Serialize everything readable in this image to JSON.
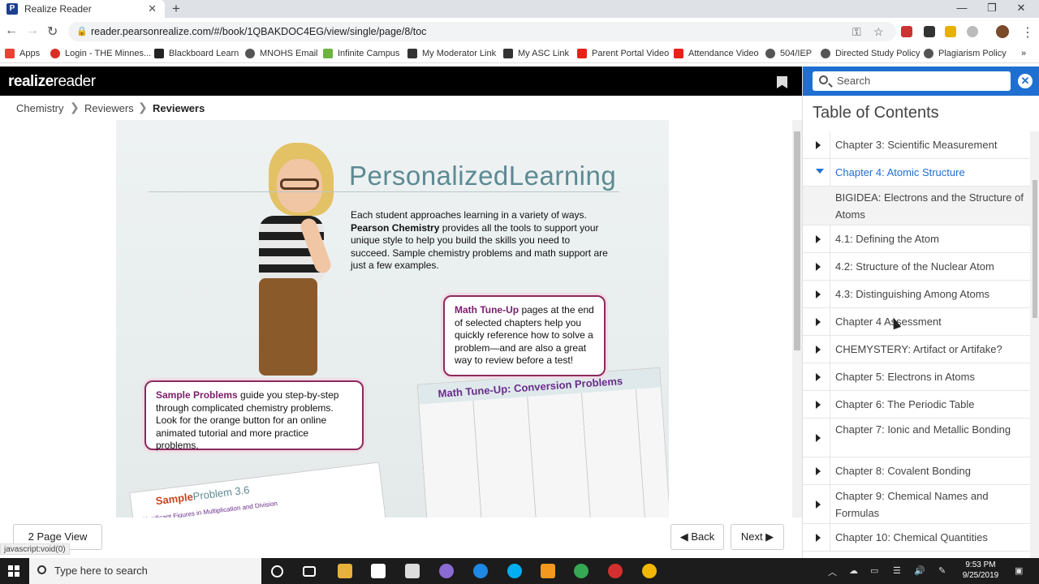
{
  "browser": {
    "tab_title": "Realize Reader",
    "tab_favicon": "P",
    "new_tab_symbol": "+",
    "url": "reader.pearsonrealize.com/#/book/1QBAKDOC4EG/view/single/page/8/toc",
    "bookmarks": [
      {
        "label": "Apps",
        "color": "#e94235"
      },
      {
        "label": "Login - THE Minnes...",
        "color": "#d93025"
      },
      {
        "label": "Blackboard Learn",
        "color": "#222222"
      },
      {
        "label": "MNOHS Email",
        "color": "#555555"
      },
      {
        "label": "Infinite Campus",
        "color": "#6cb33f"
      },
      {
        "label": "My Moderator Link",
        "color": "#333333"
      },
      {
        "label": "My ASC Link",
        "color": "#333333"
      },
      {
        "label": "Parent Portal Video",
        "color": "#e62117"
      },
      {
        "label": "Attendance Video",
        "color": "#e62117"
      },
      {
        "label": "504/IEP",
        "color": "#555555"
      },
      {
        "label": "Directed Study Policy",
        "color": "#555555"
      },
      {
        "label": "Plagiarism Policy",
        "color": "#555555"
      }
    ],
    "more_bookmarks": "»"
  },
  "app": {
    "logo_bold": "realize",
    "logo_light": "reader",
    "breadcrumbs": [
      "Chemistry",
      "Reviewers",
      "Reviewers"
    ],
    "breadcrumb_separator": "❯"
  },
  "page": {
    "title": "PersonalizedLearning",
    "body_pre": "Each student approaches learning in a variety of ways. ",
    "body_bold": "Pearson Chemistry",
    "body_post": " provides all the tools to support your unique style to help you build the skills you need to succeed. Sample chemistry problems and math support are just a few examples.",
    "callout_math_bold": "Math Tune-Up",
    "callout_math_text": " pages at the end of selected chapters help you quickly reference how to solve a problem—and are also a great way to review before a test!",
    "callout_sample_bold": "Sample Problems",
    "callout_sample_text": " guide you step-by-step through complicated chemistry problems. Look for the orange button for an online animated tutorial and more practice problems.",
    "worksheet_title": "Math Tune-Up: Conversion Problems",
    "sample_card_title": "Sample",
    "sample_card_title2": "Problem 3.6",
    "sample_card_sub": "Significant Figures in Multiplication and Division"
  },
  "controls": {
    "page_view": "2 Page View",
    "back": "Back",
    "next": "Next",
    "status_url": "javascript:void(0)"
  },
  "toc": {
    "search_placeholder": "Search",
    "close_symbol": "✕",
    "title": "Table of Contents",
    "items": [
      {
        "label": "Chapter 3: Scientific Measurement",
        "state": "collapsed"
      },
      {
        "label": "Chapter 4: Atomic Structure",
        "state": "expanded"
      },
      {
        "label": "BIGIDEA: Electrons and the Structure of Atoms",
        "state": "leaf"
      },
      {
        "label": "4.1: Defining the Atom",
        "state": "collapsed"
      },
      {
        "label": "4.2: Structure of the Nuclear Atom",
        "state": "collapsed"
      },
      {
        "label": "4.3: Distinguishing Among Atoms",
        "state": "collapsed"
      },
      {
        "label": "Chapter 4 Assessment",
        "state": "collapsed"
      },
      {
        "label": "CHEMYSTERY: Artifact or Artifake?",
        "state": "collapsed"
      },
      {
        "label": "Chapter 5: Electrons in Atoms",
        "state": "collapsed"
      },
      {
        "label": "Chapter 6: The Periodic Table",
        "state": "collapsed"
      },
      {
        "label": "Chapter 7: Ionic and Metallic Bonding",
        "state": "collapsed"
      },
      {
        "label": "Chapter 8: Covalent Bonding",
        "state": "collapsed"
      },
      {
        "label": "Chapter 9: Chemical Names and Formulas",
        "state": "collapsed"
      },
      {
        "label": "Chapter 10: Chemical Quantities",
        "state": "collapsed"
      }
    ],
    "accent_color": "#1f6fd1"
  },
  "taskbar": {
    "search_placeholder": "Type here to search",
    "time": "9:53 PM",
    "date": "9/25/2019"
  }
}
